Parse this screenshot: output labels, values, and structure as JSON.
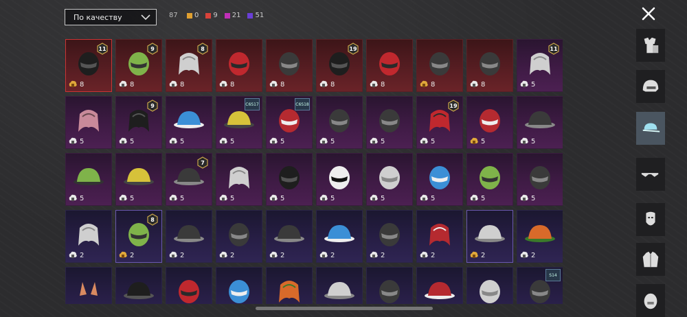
{
  "sort": {
    "label": "По качеству"
  },
  "total": "87",
  "rarity_counts": [
    {
      "color": "#e0a030",
      "value": "0"
    },
    {
      "color": "#d8423a",
      "value": "9"
    },
    {
      "color": "#c02fb8",
      "value": "21"
    },
    {
      "color": "#6a3fd6",
      "value": "51"
    }
  ],
  "sidebar": {
    "items": [
      {
        "icon": "outfit-icon",
        "active": false
      },
      {
        "icon": "helmet-icon",
        "active": false
      },
      {
        "icon": "cap-icon",
        "active": true
      },
      {
        "icon": "glasses-icon",
        "active": false
      },
      {
        "icon": "mask-icon",
        "active": false
      },
      {
        "icon": "jacket-icon",
        "active": false
      },
      {
        "icon": "face-icon",
        "active": false
      }
    ]
  },
  "items": [
    {
      "r": "red",
      "sel": true,
      "coin": "gold",
      "count": "8",
      "lvl": "11",
      "art": "helmet-black"
    },
    {
      "r": "red",
      "coin": "white",
      "count": "8",
      "lvl": "9",
      "art": "head-green"
    },
    {
      "r": "red",
      "coin": "white",
      "count": "8",
      "lvl": "8",
      "art": "hair-white"
    },
    {
      "r": "red",
      "coin": "white",
      "count": "8",
      "art": "helmet-red"
    },
    {
      "r": "red",
      "coin": "white",
      "count": "8",
      "art": "mask-fox"
    },
    {
      "r": "red",
      "coin": "white",
      "count": "8",
      "lvl": "19",
      "art": "helmet-dark"
    },
    {
      "r": "red",
      "coin": "white",
      "count": "8",
      "art": "helmet-redgold"
    },
    {
      "r": "red",
      "coin": "gold",
      "count": "8",
      "art": "helmet-horn"
    },
    {
      "r": "red",
      "coin": "white",
      "count": "8",
      "art": "skull-mask"
    },
    {
      "r": "mag",
      "coin": "white",
      "count": "5",
      "lvl": "11",
      "art": "veil-grey"
    },
    {
      "r": "mag",
      "coin": "white",
      "count": "5",
      "art": "hair-pink"
    },
    {
      "r": "mag",
      "coin": "white",
      "count": "5",
      "lvl": "9",
      "art": "hair-black"
    },
    {
      "r": "mag",
      "coin": "white",
      "count": "5",
      "art": "cap-blue"
    },
    {
      "r": "mag",
      "coin": "white",
      "count": "5",
      "tag": "C6S17",
      "art": "cap-yellow"
    },
    {
      "r": "mag",
      "coin": "white",
      "count": "5",
      "tag": "C6S18",
      "art": "hood-red"
    },
    {
      "r": "mag",
      "coin": "white",
      "count": "5",
      "art": "dragon-mask"
    },
    {
      "r": "mag",
      "coin": "white",
      "count": "5",
      "art": "spike-helmet"
    },
    {
      "r": "mag",
      "coin": "white",
      "count": "5",
      "lvl": "19",
      "art": "hair-red"
    },
    {
      "r": "mag",
      "coin": "gold",
      "count": "5",
      "art": "headphones-red"
    },
    {
      "r": "mag",
      "coin": "white",
      "count": "5",
      "art": "bird-hat"
    },
    {
      "r": "mag",
      "coin": "white",
      "count": "5",
      "art": "bucket-green"
    },
    {
      "r": "mag",
      "coin": "white",
      "count": "5",
      "art": "straw-hat"
    },
    {
      "r": "mag",
      "coin": "white",
      "count": "5",
      "lvl": "7",
      "art": "crown-hat"
    },
    {
      "r": "mag",
      "coin": "white",
      "count": "5",
      "art": "dreads-grey"
    },
    {
      "r": "mag",
      "coin": "white",
      "count": "5",
      "art": "bandana-dark"
    },
    {
      "r": "mag",
      "coin": "white",
      "count": "5",
      "art": "zebra-head"
    },
    {
      "r": "mag",
      "coin": "white",
      "count": "5",
      "art": "sheep-head"
    },
    {
      "r": "mag",
      "coin": "white",
      "count": "5",
      "art": "blue-mask"
    },
    {
      "r": "mag",
      "coin": "white",
      "count": "5",
      "art": "frog-head"
    },
    {
      "r": "mag",
      "coin": "white",
      "count": "5",
      "art": "skull-balaclava"
    },
    {
      "r": "pur",
      "coin": "white",
      "count": "2",
      "art": "hair-grey"
    },
    {
      "r": "pur",
      "sel": true,
      "coin": "gold",
      "count": "2",
      "lvl": "8",
      "art": "skull-green"
    },
    {
      "r": "pur",
      "coin": "white",
      "count": "2",
      "art": "cap-camo"
    },
    {
      "r": "pur",
      "coin": "white",
      "count": "2",
      "art": "helmet-goggle"
    },
    {
      "r": "pur",
      "coin": "white",
      "count": "2",
      "art": "beanie-scarf"
    },
    {
      "r": "pur",
      "coin": "white",
      "count": "2",
      "art": "cap-lightblue"
    },
    {
      "r": "pur",
      "coin": "white",
      "count": "2",
      "art": "horn-visor"
    },
    {
      "r": "pur",
      "coin": "white",
      "count": "2",
      "art": "bow-hair"
    },
    {
      "r": "pur",
      "sel": true,
      "coin": "gold",
      "count": "2",
      "art": "sun-hat"
    },
    {
      "r": "pur",
      "coin": "white",
      "count": "2",
      "art": "beanie-rasta"
    },
    {
      "r": "pur",
      "coin": "white",
      "count": "",
      "art": "cat-ears"
    },
    {
      "r": "pur",
      "coin": "white",
      "count": "",
      "art": "hat-dark"
    },
    {
      "r": "pur",
      "coin": "white",
      "count": "",
      "art": "helmet-redsport"
    },
    {
      "r": "pur",
      "coin": "white",
      "count": "",
      "art": "helmet-cricket"
    },
    {
      "r": "pur",
      "coin": "white",
      "count": "",
      "art": "hair-orange"
    },
    {
      "r": "pur",
      "coin": "white",
      "count": "",
      "art": "beanie-grey"
    },
    {
      "r": "pur",
      "coin": "white",
      "count": "",
      "art": "ski-goggle"
    },
    {
      "r": "pur",
      "coin": "white",
      "count": "",
      "art": "mushroom-hat"
    },
    {
      "r": "pur",
      "coin": "white",
      "count": "",
      "art": "turban-grey"
    },
    {
      "r": "pur",
      "coin": "white",
      "count": "",
      "tag": "S14",
      "art": "helmet-spartan"
    }
  ]
}
